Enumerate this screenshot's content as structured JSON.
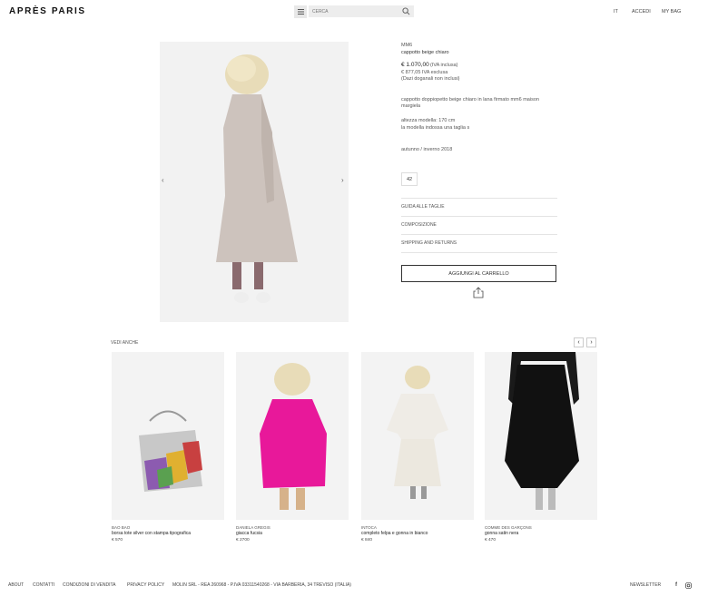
{
  "header": {
    "logo": "APRÈS PARIS",
    "search_placeholder": "CERCA",
    "lang": "IT",
    "login": "ACCEDI",
    "bag": "MY BAG"
  },
  "product": {
    "brand": "MM6",
    "name": "cappotto beige chiaro",
    "price": "€ 1.070,00",
    "price_note": "(IVA inclusa)",
    "price_ex_vat": "€ 877,05 IVA esclusa",
    "duty_note": "(Dazi doganali non inclusi)",
    "desc_line1": "cappotto doppiopetto beige chiaro in lana firmato mm6 maison",
    "desc_line2": "margiela",
    "model_height": "altezza modella: 170 cm",
    "model_size": "la modella indossa una taglia s",
    "season": "autunno / inverno 2018",
    "size": "42",
    "accordion": [
      "GUIDA ALLE TAGLIE",
      "COMPOSIZIONE",
      "SHIPPING AND RETURNS"
    ],
    "add_to_cart": "AGGIUNGI AL CARRELLO"
  },
  "related": {
    "title": "VEDI ANCHE",
    "items": [
      {
        "brand": "BAO BAO",
        "name": "borsa tote silver con stampa tipografica",
        "price": "€ 570"
      },
      {
        "brand": "DANIELA GREGIS",
        "name": "giacca fucsia",
        "price": "€ 2700"
      },
      {
        "brand": "INTOCA",
        "name": "completo felpa e gonna in bianco",
        "price": "€ 840"
      },
      {
        "brand": "COMME DES GARÇONS",
        "name": "gonna satin nera",
        "price": "€ 470"
      }
    ]
  },
  "footer": {
    "about": "ABOUT",
    "contacts": "CONTATTI",
    "terms": "CONDIZIONI DI VENDITA",
    "privacy": "PRIVACY POLICY",
    "company": "MOLIN SRL - REA 260968 - P.IVA 03311540268 - VIA BARBERIA, 34 TREVISO (ITALIA)",
    "newsletter": "NEWSLETTER"
  }
}
